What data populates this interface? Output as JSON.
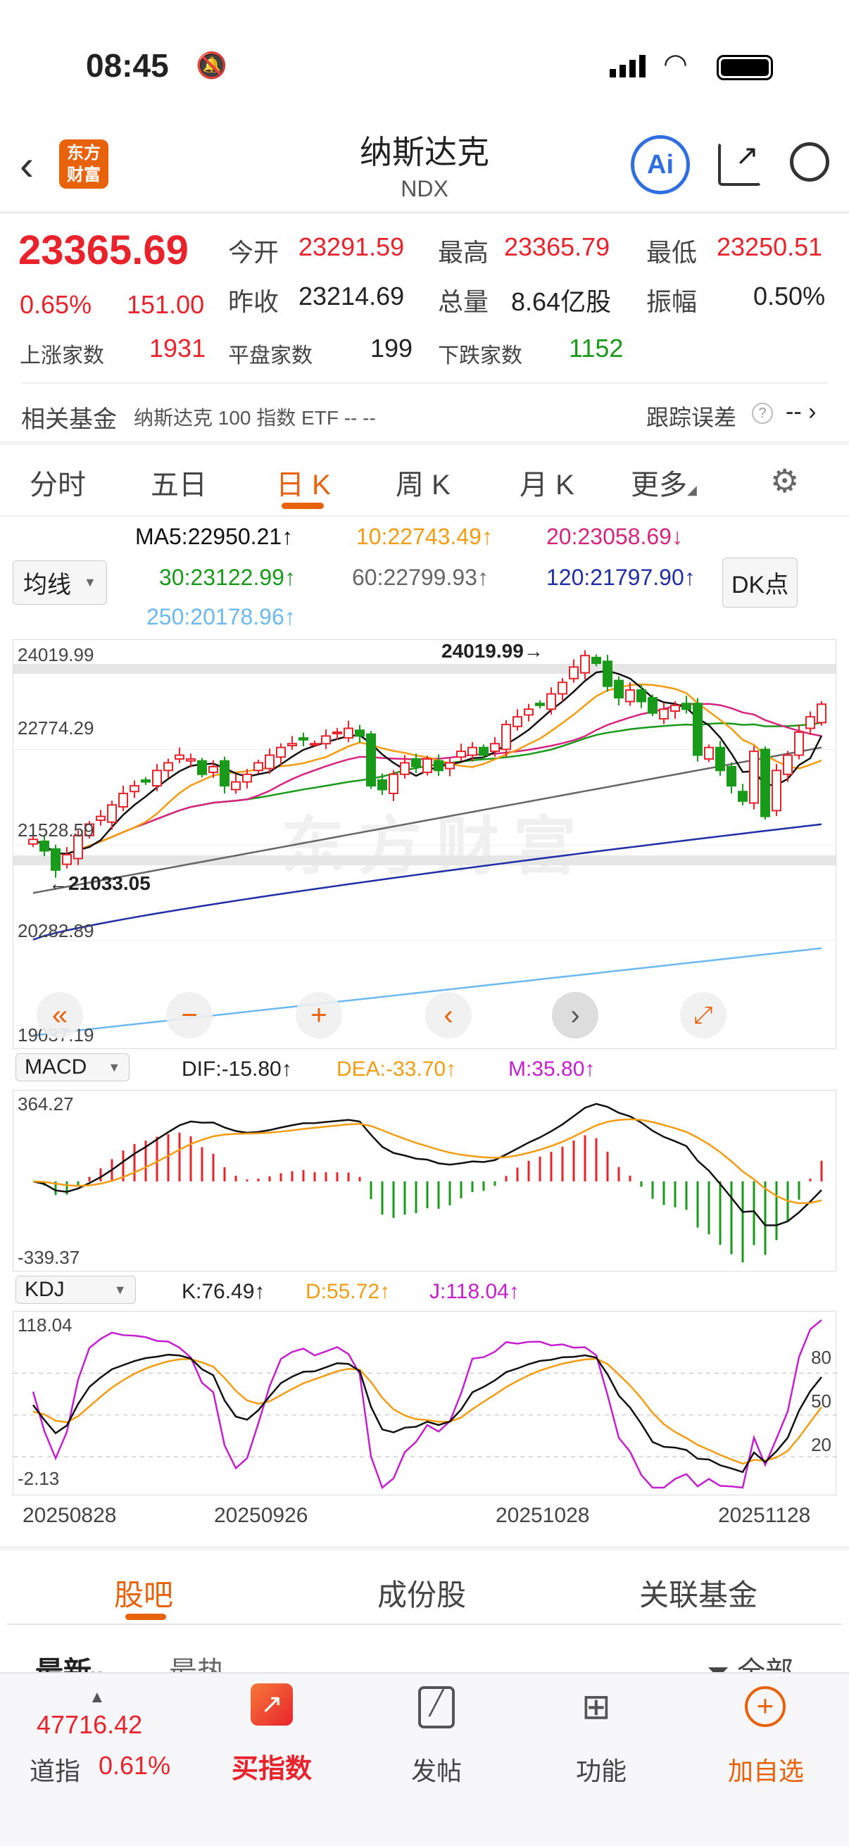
{
  "status_bar": {
    "time": "08:45"
  },
  "header": {
    "logo_text": "东方财富",
    "title": "纳斯达克",
    "code": "NDX",
    "ai_label": "Ai"
  },
  "quote": {
    "price": "23365.69",
    "change_pct": "0.65%",
    "change": "151.00",
    "open_label": "今开",
    "open": "23291.59",
    "high_label": "最高",
    "high": "23365.79",
    "low_label": "最低",
    "low": "23250.51",
    "prev_close_label": "昨收",
    "prev_close": "23214.69",
    "volume_label": "总量",
    "volume": "8.64亿股",
    "amplitude_label": "振幅",
    "amplitude": "0.50%",
    "up_label": "上涨家数",
    "up": "1931",
    "flat_label": "平盘家数",
    "flat": "199",
    "down_label": "下跌家数",
    "down": "1152"
  },
  "fund": {
    "label": "相关基金",
    "name": "纳斯达克 100 指数 ETF -- --",
    "tracking_label": "跟踪误差",
    "tracking_value": "--"
  },
  "tabs": [
    {
      "label": "分时"
    },
    {
      "label": "五日"
    },
    {
      "label": "日 K",
      "active": true
    },
    {
      "label": "周 K"
    },
    {
      "label": "月 K"
    },
    {
      "label": "更多"
    }
  ],
  "ma": {
    "selector": "均线",
    "dk": "DK点",
    "ma5": "MA5:22950.21↑",
    "ma10": "10:22743.49↑",
    "ma20": "20:23058.69↓",
    "ma30": "30:23122.99↑",
    "ma60": "60:22799.93↑",
    "ma120": "120:21797.90↑",
    "ma250": "250:20178.96↑"
  },
  "colors": {
    "up": "#e8232b",
    "down": "#1a9a1a",
    "ma5": "#111111",
    "ma10": "#f39c12",
    "ma20": "#d6247f",
    "ma30": "#1a9a1a",
    "ma60": "#666666",
    "ma120": "#1f2fa8",
    "ma250": "#6cb8f0",
    "accent": "#e8620c"
  },
  "macd": {
    "selector": "MACD",
    "dif": "DIF:-15.80↑",
    "dea": "DEA:-33.70↑",
    "m": "M:35.80↑",
    "max_label": "364.27",
    "min_label": "-339.37"
  },
  "kdj": {
    "selector": "KDJ",
    "k": "K:76.49↑",
    "d": "D:55.72↑",
    "j": "J:118.04↑",
    "max_label": "118.04",
    "min_label": "-2.13",
    "levels": [
      "80",
      "50",
      "20"
    ]
  },
  "chart_data": {
    "type": "candlestick",
    "y_labels": [
      "24019.99",
      "22774.29",
      "21528.59",
      "20282.89",
      "19037.19"
    ],
    "ylim": [
      19037.19,
      24019.99
    ],
    "x_labels": [
      "20250828",
      "20250926",
      "20251028",
      "20251128"
    ],
    "high_annotation": "24019.99→",
    "low_annotation": "←21033.05",
    "close": [
      21600,
      21450,
      21200,
      21400,
      21650,
      21800,
      21900,
      22050,
      22200,
      22300,
      22350,
      22500,
      22600,
      22700,
      22650,
      22450,
      22550,
      22300,
      22350,
      22450,
      22600,
      22700,
      22800,
      22850,
      22900,
      22850,
      22950,
      23000,
      23050,
      22950,
      22300,
      22250,
      22450,
      22600,
      22550,
      22650,
      22500,
      22600,
      22750,
      22800,
      22700,
      22850,
      23100,
      23200,
      23300,
      23350,
      23500,
      23650,
      23850,
      24000,
      23900,
      23600,
      23450,
      23550,
      23400,
      23250,
      23300,
      23350,
      23300,
      22700,
      22800,
      22500,
      22300,
      22100,
      22750,
      21900,
      22500,
      22700,
      23000,
      23200,
      23365
    ],
    "ma60_range": [
      20900,
      22800
    ],
    "ma120_range": [
      20290,
      21797.9
    ],
    "ma250_range": [
      19040,
      20178.96
    ]
  },
  "bottom_tabs": [
    {
      "label": "股吧"
    },
    {
      "label": "成份股"
    },
    {
      "label": "关联基金"
    }
  ],
  "feed": {
    "latest": "最新",
    "hot": "最热",
    "all": "全部"
  },
  "nav": {
    "dow_value": "47716.42",
    "dow_label": "道指",
    "dow_pct": "0.61%",
    "buy": "买指数",
    "post": "发帖",
    "func": "功能",
    "add": "加自选"
  }
}
